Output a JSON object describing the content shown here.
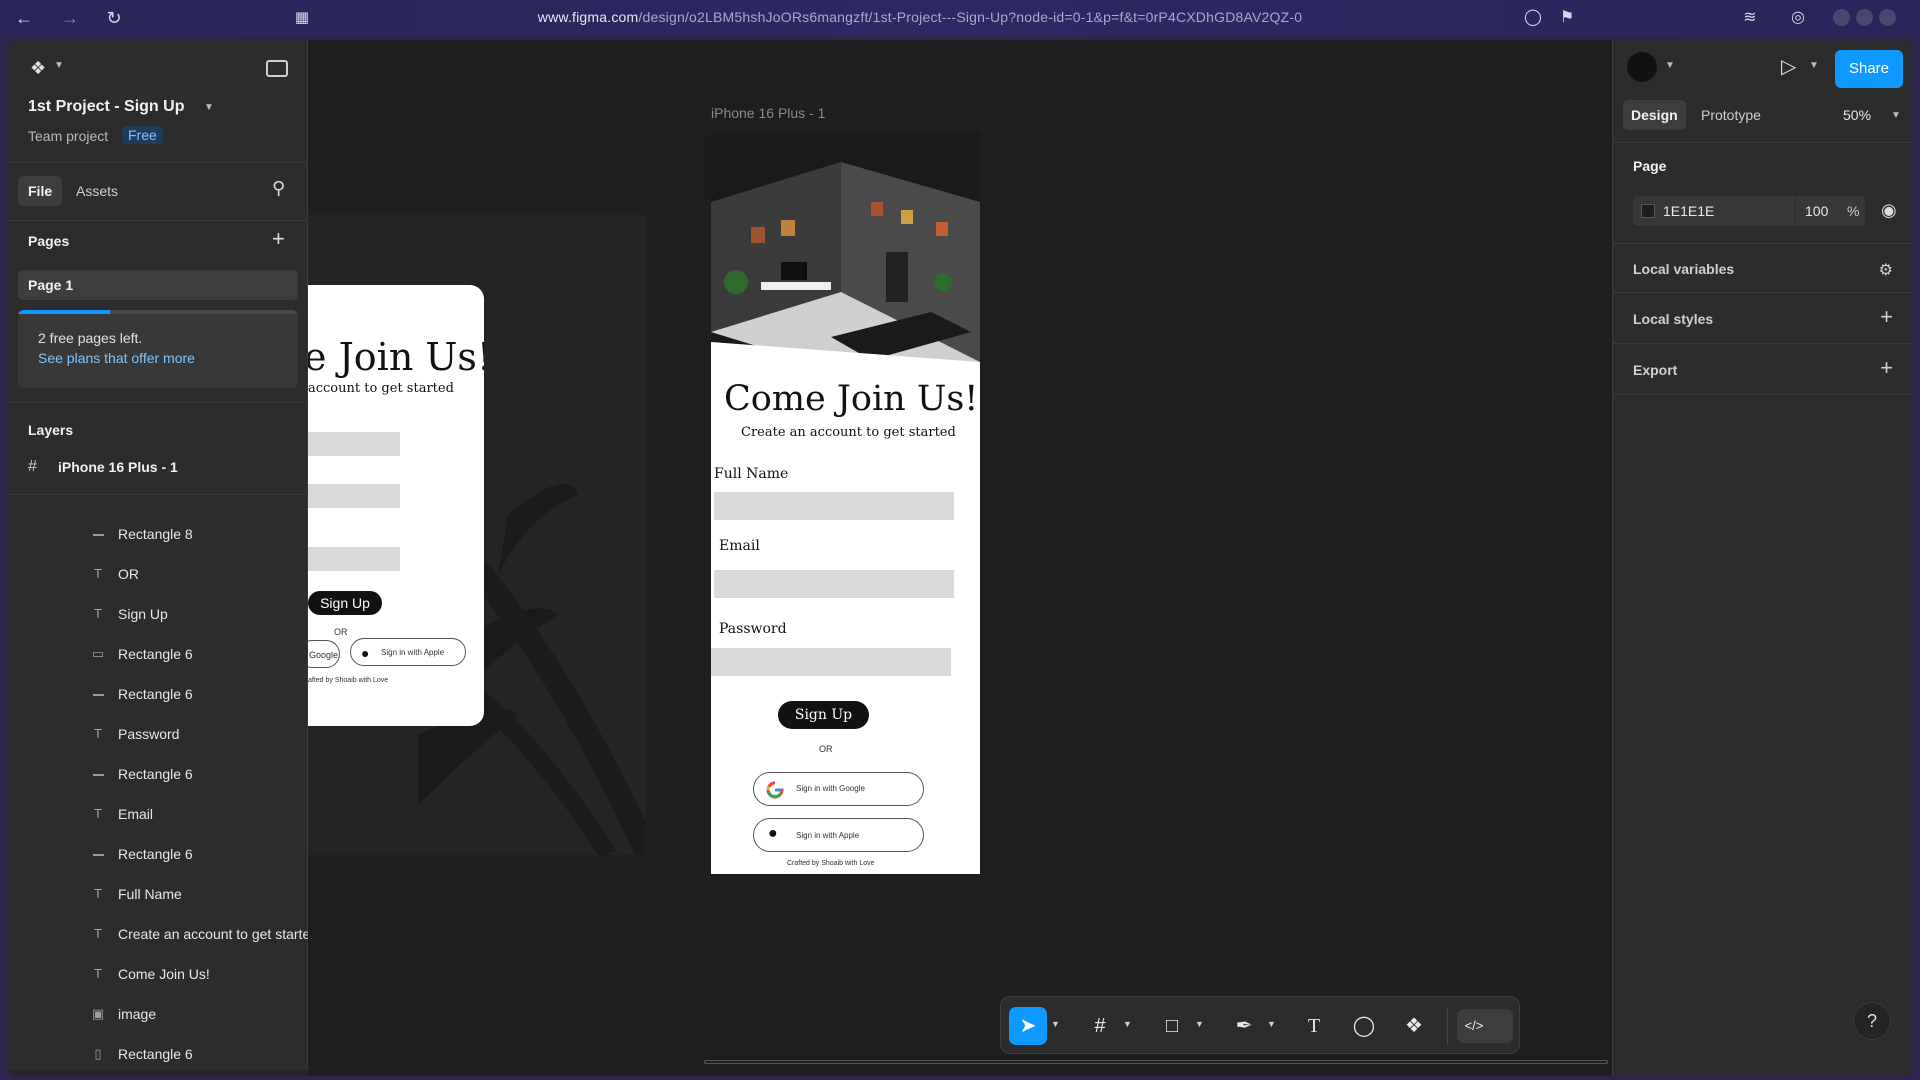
{
  "browser": {
    "url_domain": "www.figma.com",
    "url_path": "/design/o2LBM5hshJoORs6mangzft/1st-Project---Sign-Up?node-id=0-1&p=f&t=0rP4CXDhGD8AV2QZ-0"
  },
  "file": {
    "title": "1st Project - Sign Up",
    "team": "Team project",
    "plan_badge": "Free"
  },
  "left_tabs": {
    "file": "File",
    "assets": "Assets"
  },
  "pages": {
    "title": "Pages",
    "items": [
      "Page 1"
    ],
    "notice_line1": "2 free pages left.",
    "notice_link": "See plans that offer more",
    "pages_used_fraction": 0.33
  },
  "layers": {
    "title": "Layers",
    "frame": "iPhone 16 Plus - 1",
    "items": [
      {
        "name": "Rectangle 8",
        "icon": "rect-line-icon"
      },
      {
        "name": "OR",
        "icon": "text-icon"
      },
      {
        "name": "Sign Up",
        "icon": "text-icon"
      },
      {
        "name": "Rectangle 6",
        "icon": "rect-icon"
      },
      {
        "name": "Rectangle 6",
        "icon": "rect-line-icon"
      },
      {
        "name": "Password",
        "icon": "text-icon"
      },
      {
        "name": "Rectangle 6",
        "icon": "rect-line-icon"
      },
      {
        "name": "Email",
        "icon": "text-icon"
      },
      {
        "name": "Rectangle 6",
        "icon": "rect-line-icon"
      },
      {
        "name": "Full Name",
        "icon": "text-icon"
      },
      {
        "name": "Create an account to get started",
        "icon": "text-icon"
      },
      {
        "name": "Come Join Us!",
        "icon": "text-icon"
      },
      {
        "name": "image",
        "icon": "image-icon"
      },
      {
        "name": "Rectangle 6",
        "icon": "rect-vertical-icon"
      }
    ]
  },
  "right": {
    "tabs": {
      "design": "Design",
      "prototype": "Prototype"
    },
    "zoom": "50%",
    "share": "Share",
    "page_section": "Page",
    "page_color": "1E1E1E",
    "page_opacity": "100",
    "opacity_unit": "%",
    "local_variables": "Local variables",
    "local_styles": "Local styles",
    "export": "Export"
  },
  "canvas": {
    "frame_label": "iPhone 16 Plus - 1",
    "design": {
      "heading": "Come Join Us!",
      "subheading": "Create an account to get started",
      "full_name_label": "Full Name",
      "email_label": "Email",
      "password_label": "Password",
      "signup_button": "Sign Up",
      "or_text": "OR",
      "google_button": "Sign in with Google",
      "apple_button": "Sign in  with Apple",
      "footer": "Crafted by Shoaib with Love"
    },
    "card": {
      "heading_partial": "e Join Us!",
      "subheading_partial": "account to get started",
      "signup_button": "Sign Up",
      "or_text": "OR",
      "google_partial": "Google",
      "apple_button": "Sign in  with Apple",
      "footer_partial": "afted by Shoaib with Love"
    }
  },
  "help": "?",
  "colors": {
    "accent": "#0d99ff",
    "panel": "#2c2c2c",
    "canvas": "#1e1e1e"
  }
}
